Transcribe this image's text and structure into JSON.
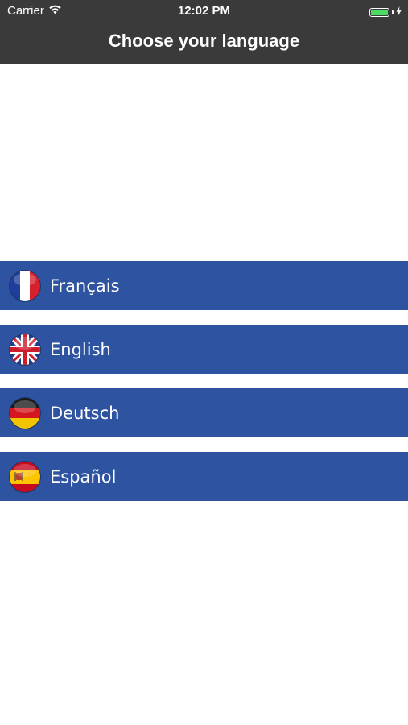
{
  "status_bar": {
    "carrier": "Carrier",
    "time": "12:02 PM",
    "battery_color": "#4cd964"
  },
  "nav": {
    "title": "Choose your language"
  },
  "languages": [
    {
      "label": "Français",
      "flag": "france-flag-icon"
    },
    {
      "label": "English",
      "flag": "uk-flag-icon"
    },
    {
      "label": "Deutsch",
      "flag": "germany-flag-icon"
    },
    {
      "label": "Español",
      "flag": "spain-flag-icon"
    }
  ],
  "colors": {
    "bar_background": "#3a3a3a",
    "row_background": "#2e53a0"
  }
}
